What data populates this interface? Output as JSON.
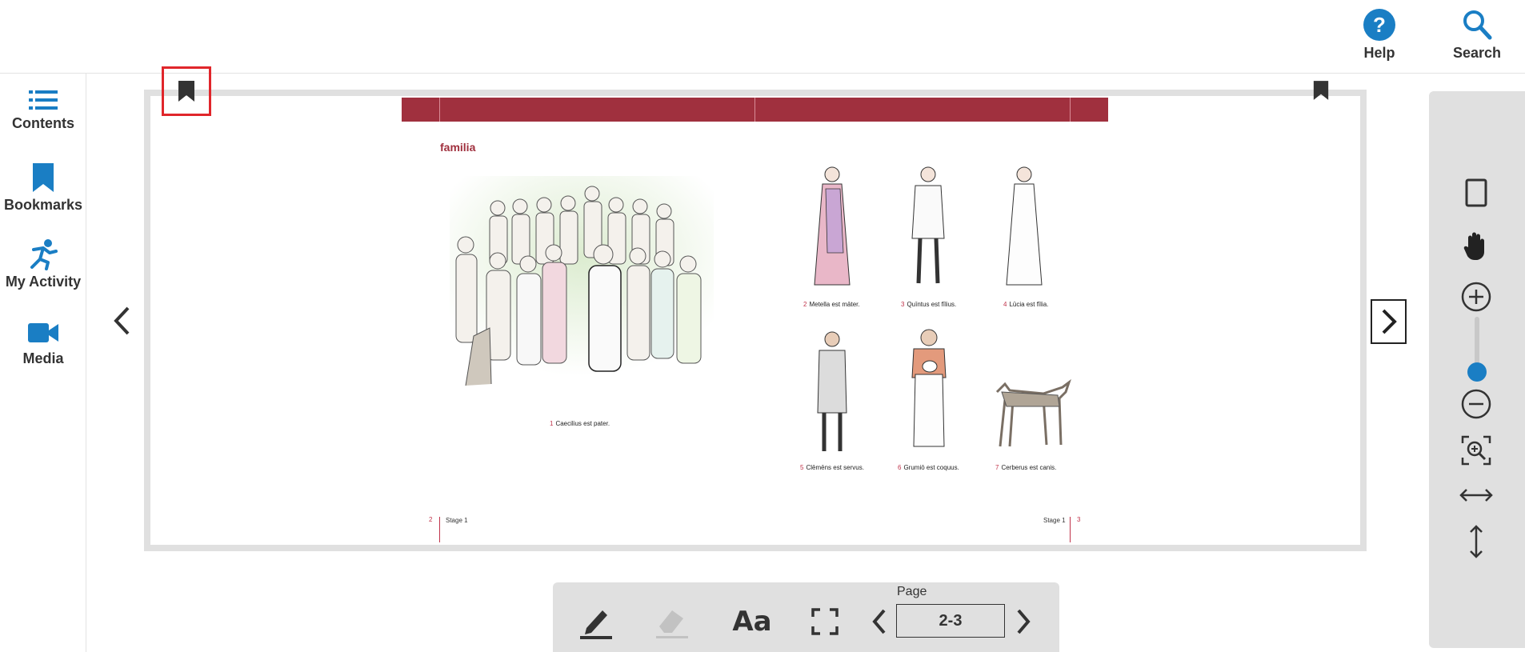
{
  "header": {
    "help_label": "Help",
    "search_label": "Search"
  },
  "sidebar": {
    "items": [
      {
        "label": "Contents",
        "icon": "list-icon"
      },
      {
        "label": "Bookmarks",
        "icon": "bookmark-icon"
      },
      {
        "label": "My Activity",
        "icon": "activity-icon"
      },
      {
        "label": "Media",
        "icon": "video-camera-icon"
      }
    ]
  },
  "book": {
    "left_page": {
      "title": "familia",
      "caption_num": "1",
      "caption": "Caecilius est pater.",
      "folio_number": "2",
      "folio_stage": "Stage 1"
    },
    "right_page": {
      "captions": [
        {
          "num": "2",
          "text": "Metella est māter."
        },
        {
          "num": "3",
          "text": "Quīntus est fīlius."
        },
        {
          "num": "4",
          "text": "Lūcia est fīlia."
        },
        {
          "num": "5",
          "text": "Clēmēns est servus."
        },
        {
          "num": "6",
          "text": "Grumiō est coquus."
        },
        {
          "num": "7",
          "text": "Cerberus est canis."
        }
      ],
      "folio_number": "3",
      "folio_stage": "Stage 1"
    }
  },
  "bottom_toolbar": {
    "page_label": "Page",
    "page_value": "2-3"
  },
  "colors": {
    "accent": "#1a7ec4",
    "book_red": "#a0303e",
    "highlight_border": "#e0262b",
    "toolbar_bg": "#e0e0e0"
  }
}
